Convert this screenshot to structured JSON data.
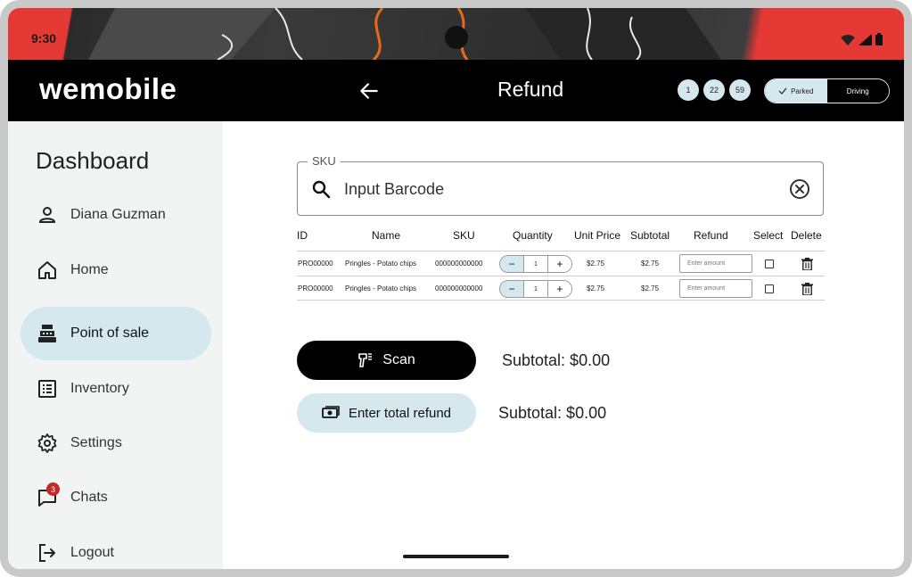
{
  "status_bar": {
    "time": "9:30",
    "icons": [
      "wifi-icon",
      "signal-icon",
      "battery-icon"
    ]
  },
  "header": {
    "logo": "wemobile",
    "title": "Refund",
    "badges": [
      "1",
      "22",
      "59"
    ],
    "mode_toggle": {
      "options": [
        "Parked",
        "Driving"
      ],
      "selected": "Parked"
    }
  },
  "sidebar": {
    "title": "Dashboard",
    "items": [
      {
        "label": "Diana Guzman",
        "icon": "person-icon"
      },
      {
        "label": "Home",
        "icon": "home-icon"
      },
      {
        "label": "Point of sale",
        "icon": "cash-register-icon",
        "active": true
      },
      {
        "label": "Inventory",
        "icon": "list-icon"
      },
      {
        "label": "Settings",
        "icon": "gear-icon"
      },
      {
        "label": "Chats",
        "icon": "chat-icon",
        "badge": "3"
      },
      {
        "label": "Logout",
        "icon": "logout-icon"
      }
    ]
  },
  "sku_field": {
    "label": "SKU",
    "placeholder": "Input Barcode"
  },
  "table": {
    "columns": [
      "ID",
      "Name",
      "SKU",
      "Quantity",
      "Unit Price",
      "Subtotal",
      "Refund",
      "Select",
      "Delete"
    ],
    "rows": [
      {
        "id": "PRO00000",
        "name": "Pringles - Potato chips",
        "sku": "000000000000",
        "quantity": "1",
        "unit_price": "$2.75",
        "subtotal": "$2.75",
        "refund_placeholder": "Enter amount"
      },
      {
        "id": "PRO00000",
        "name": "Pringles - Potato chips",
        "sku": "000000000000",
        "quantity": "1",
        "unit_price": "$2.75",
        "subtotal": "$2.75",
        "refund_placeholder": "Enter amount"
      }
    ]
  },
  "actions": {
    "scan_label": "Scan",
    "scan_subtotal": "Subtotal: $0.00",
    "refund_label": "Enter total refund",
    "refund_subtotal": "Subtotal: $0.00"
  },
  "colors": {
    "accent": "#d4e8ee",
    "header_bg": "#000000",
    "sidebar_bg": "#f2f3f3",
    "badge_red": "#c62828"
  }
}
